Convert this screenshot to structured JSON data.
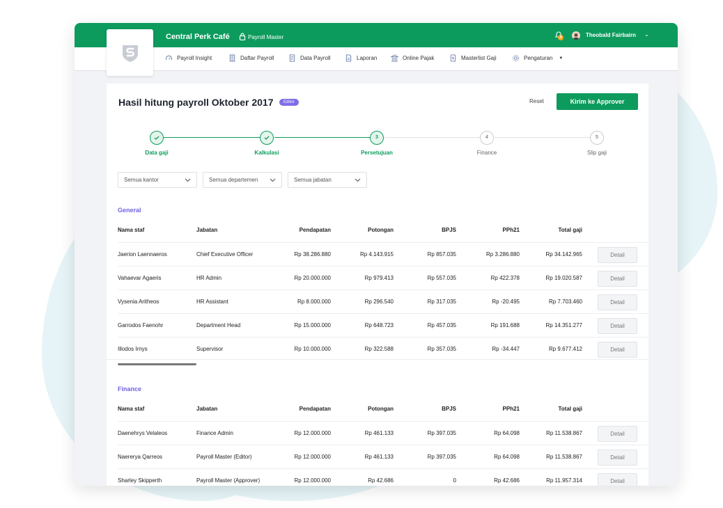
{
  "header": {
    "app_title": "Central Perk Café",
    "role": "Payroll Master",
    "notification_count": "4",
    "user_name": "Theobald Fairbairn"
  },
  "nav": [
    {
      "label": "Payroll Insight",
      "icon": "gauge-icon"
    },
    {
      "label": "Daftar Payroll",
      "icon": "building-list-icon"
    },
    {
      "label": "Data Payroll",
      "icon": "document-icon"
    },
    {
      "label": "Laporan",
      "icon": "report-icon"
    },
    {
      "label": "Online Pajak",
      "icon": "bank-icon"
    },
    {
      "label": "Masterlist Gaji",
      "icon": "money-file-icon"
    },
    {
      "label": "Pengaturan",
      "icon": "gear-icon"
    }
  ],
  "page": {
    "title": "Hasil hitung payroll Oktober 2017",
    "editor_badge": "Editor",
    "reset_label": "Reset",
    "approve_label": "Kirim ke Approver"
  },
  "steps": [
    {
      "number": "",
      "label": "Data gaji",
      "state": "done"
    },
    {
      "number": "",
      "label": "Kalkulasi",
      "state": "done"
    },
    {
      "number": "3",
      "label": "Persetujuan",
      "state": "active"
    },
    {
      "number": "4",
      "label": "Finance",
      "state": "todo"
    },
    {
      "number": "5",
      "label": "Slip gaji",
      "state": "todo"
    }
  ],
  "filters": [
    "Semua kantor",
    "Semua departemen",
    "Semua jabatan"
  ],
  "columns": [
    "Nama staf",
    "Jabatan",
    "Pendapatan",
    "Potongan",
    "BPJS",
    "PPh21",
    "Total gaji"
  ],
  "detail_label": "Detail",
  "sections": [
    {
      "title": "General",
      "rows": [
        [
          "Jaerion Laennaeros",
          "Chief Executive Officer",
          "Rp 38.286.880",
          "Rp 4.143.915",
          "Rp 857.035",
          "Rp 3.286.880",
          "Rp 34.142.965"
        ],
        [
          "Vahaevar Agaeris",
          "HR Admin",
          "Rp 20.000.000",
          "Rp 979.413",
          "Rp 557.035",
          "Rp 422.378",
          "Rp 19.020.587"
        ],
        [
          "Vysenia Aritheos",
          "HR Assistant",
          "Rp 8.000.000",
          "Rp 296.540",
          "Rp 317.035",
          "Rp -20.495",
          "Rp 7.703.460"
        ],
        [
          "Garrodos Faenohr",
          "Department Head",
          "Rp 15.000.000",
          "Rp 648.723",
          "Rp 457.035",
          "Rp 191.688",
          "Rp 14.351.277"
        ],
        [
          "Illodos Irnys",
          "Supervisor",
          "Rp 10.000.000",
          "Rp 322.588",
          "Rp 357.035",
          "Rp -34.447",
          "Rp 9.677.412"
        ]
      ]
    },
    {
      "title": "Finance",
      "rows": [
        [
          "Daenehrys Velaleos",
          "Finance Admin",
          "Rp 12.000.000",
          "Rp 461.133",
          "Rp 397.035",
          "Rp 64.098",
          "Rp 11.538.867"
        ],
        [
          "Naererya Qarreos",
          "Payroll Master (Editor)",
          "Rp 12.000.000",
          "Rp 461.133",
          "Rp 397.035",
          "Rp 64.098",
          "Rp 11.538.867"
        ],
        [
          "Sharley Skipperth",
          "Payroll Master (Approver)",
          "Rp 12.000.000",
          "Rp 42.686",
          "0",
          "Rp 42.686",
          "Rp 11.957.314"
        ]
      ]
    }
  ],
  "colors": {
    "brand": "#0d9b5d",
    "accent": "#6f62e0",
    "badge": "#f5a623"
  }
}
